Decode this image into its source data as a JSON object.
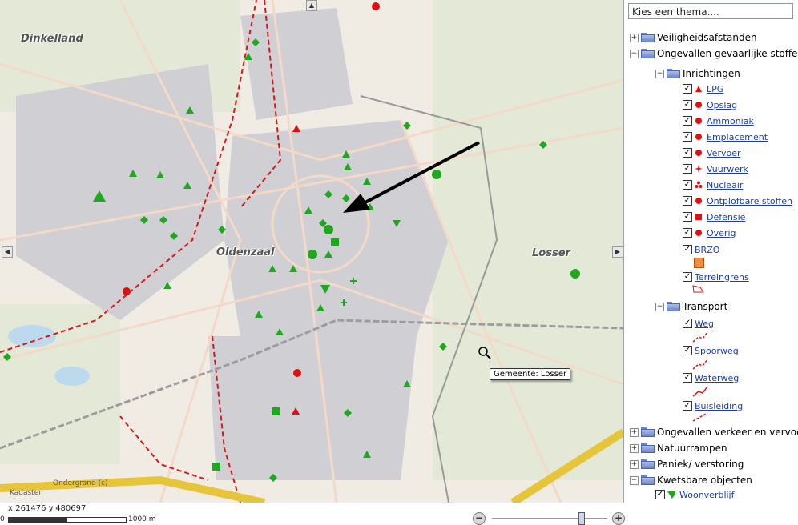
{
  "map": {
    "towns": {
      "dinkelland": "Dinkelland",
      "oldenzaal": "Oldenzaal",
      "losser": "Losser"
    },
    "tooltip": "Gemeente: Losser",
    "attribution_kadaster": "Kadaster",
    "attribution_ondergrond": "Ondergrond (c)",
    "coordinates": "x:261476 y:480697",
    "scale_zero": "0",
    "scale_end": "1000 m",
    "zoom_in": "+",
    "zoom_out": "−",
    "colors": {
      "background": "#f0ece4",
      "roads": "#f3d9c8",
      "markers": "#1fa81f",
      "incidents": "#e01010",
      "borders": "#d81818",
      "rail": "#9c9c9c"
    }
  },
  "panel": {
    "theme_select": "Kies een thema....",
    "tree": {
      "veiligheid": "Veiligheidsafstanden",
      "ongevallen_stoffen": "Ongevallen gevaarlijke stoffen",
      "inrichtingen": "Inrichtingen",
      "inrichtingen_items": [
        "LPG",
        "Opslag",
        "Ammoniak",
        "Emplacement",
        "Vervoer",
        "Vuurwerk",
        "Nucleair",
        "Ontplofbare stoffen",
        "Defensie",
        "Overig"
      ],
      "brzo": "BRZO",
      "terreingrens": "Terreingrens",
      "transport": "Transport",
      "transport_items": [
        "Weg",
        "Spoorweg",
        "Waterweg",
        "Buisleiding"
      ],
      "verkeer": "Ongevallen verkeer en vervoer",
      "natuurrampen": "Natuurrampen",
      "paniek": "Paniek/ verstoring",
      "kwetsbare": "Kwetsbare objecten",
      "woonverblijf": "Woonverblijf"
    },
    "icons": {
      "expanded": "minus-icon",
      "collapsed": "plus-icon",
      "folder": "folder-icon",
      "checked": "checkbox-checked"
    }
  }
}
